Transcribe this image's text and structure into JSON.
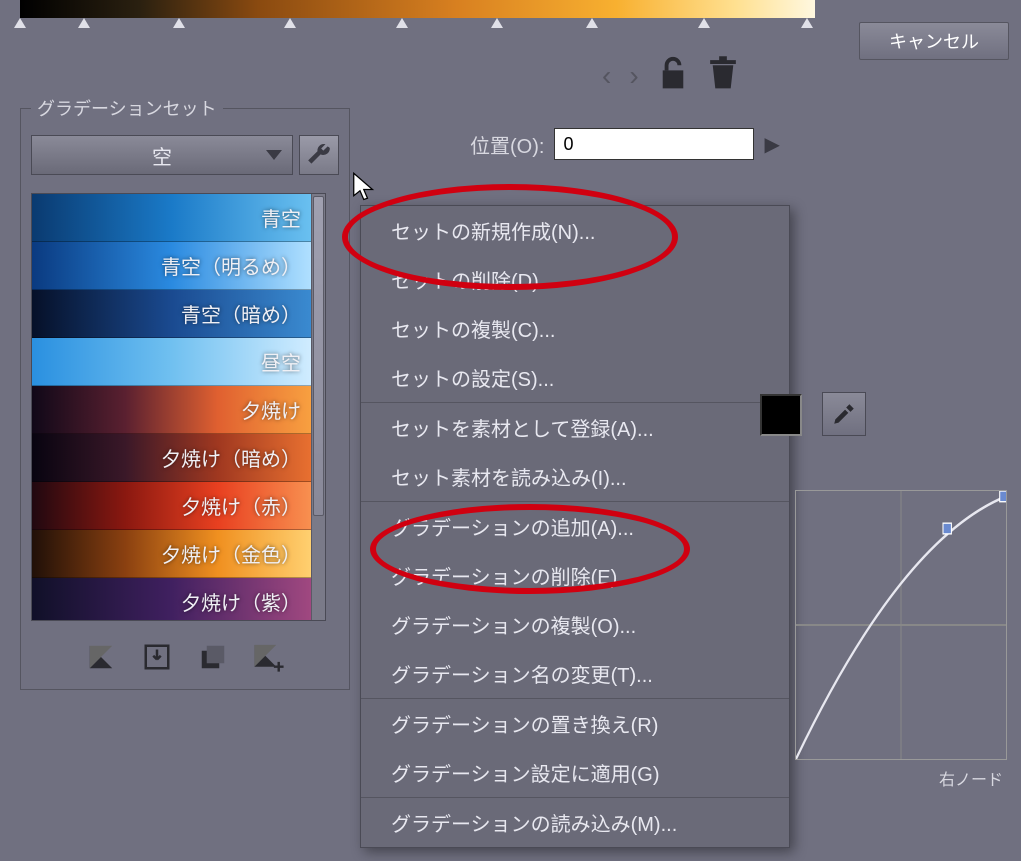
{
  "top_gradient_stops_pct": [
    0,
    8,
    20,
    34,
    48,
    60,
    72,
    86,
    99
  ],
  "buttons": {
    "cancel": "キャンセル"
  },
  "set_panel": {
    "title": "グラデーションセット",
    "selected": "空"
  },
  "position": {
    "label": "位置(O):",
    "value": "0"
  },
  "presets": [
    {
      "label": "青空",
      "css": "linear-gradient(to right,#0a3a70,#1a7ac8,#6ac0f0)"
    },
    {
      "label": "青空（明るめ）",
      "css": "linear-gradient(to right,#0a3a80,#2a8ae0,#b0e0ff)"
    },
    {
      "label": "青空（暗め）",
      "css": "linear-gradient(to right,#061028,#1a4a90,#3a8ad0)"
    },
    {
      "label": "昼空",
      "css": "linear-gradient(to right,#2a90e0,#70c0f0,#d0ecff)"
    },
    {
      "label": "夕焼け",
      "css": "linear-gradient(to right,#100818,#5a2030,#e06030,#f8a040)"
    },
    {
      "label": "夕焼け（暗め）",
      "css": "linear-gradient(to right,#080410,#3a1828,#a03820,#e87030)"
    },
    {
      "label": "夕焼け（赤）",
      "css": "linear-gradient(to right,#200810,#8a1810,#e84020,#f89050)"
    },
    {
      "label": "夕焼け（金色）",
      "css": "linear-gradient(to right,#201008,#8a4010,#f09020,#ffd070)"
    },
    {
      "label": "夕焼け（紫）",
      "css": "linear-gradient(to right,#101028,#402060,#a04880)"
    }
  ],
  "context_menu": {
    "groups": [
      [
        "セットの新規作成(N)...",
        "セットの削除(D)...",
        "セットの複製(C)...",
        "セットの設定(S)..."
      ],
      [
        "セットを素材として登録(A)...",
        "セット素材を読み込み(I)..."
      ],
      [
        "グラデーションの追加(A)...",
        "グラデーションの削除(E)",
        "グラデーションの複製(O)...",
        "グラデーション名の変更(T)..."
      ],
      [
        "グラデーションの置き換え(R)",
        "グラデーション設定に適用(G)"
      ],
      [
        "グラデーションの読み込み(M)..."
      ]
    ]
  },
  "curve": {
    "right_node_label": "右ノード"
  },
  "icons": {
    "lock": "lock-icon",
    "trash": "trash-icon",
    "wrench": "wrench-icon",
    "eyedropper": "eyedropper-icon"
  }
}
